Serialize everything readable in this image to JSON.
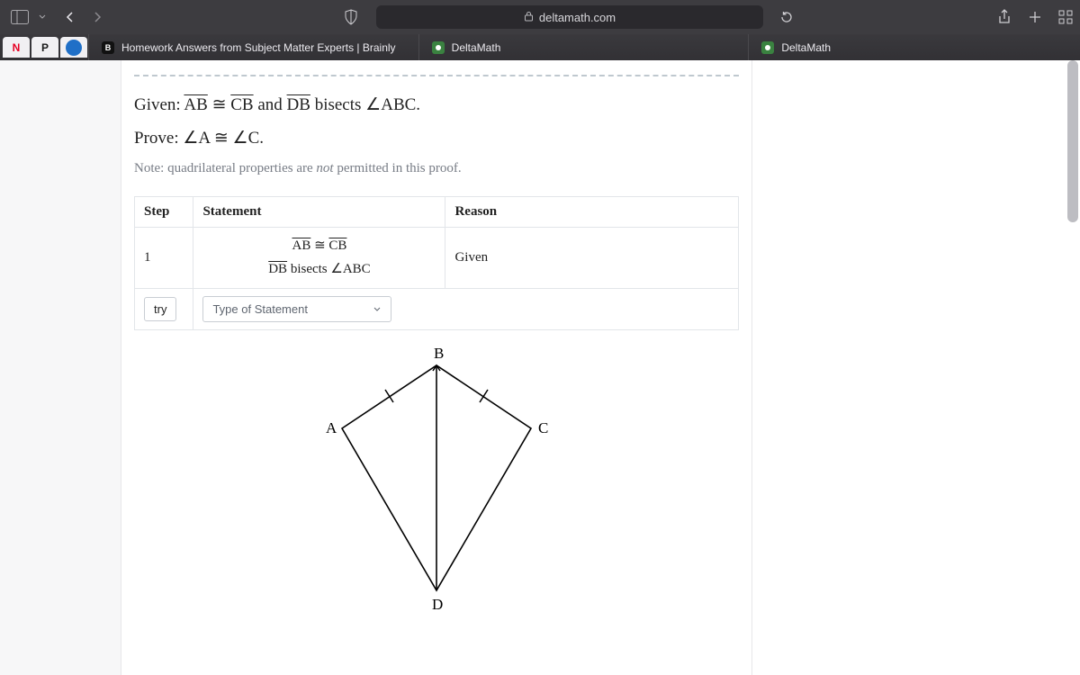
{
  "browser": {
    "url_domain": "deltamath.com",
    "tabs": [
      {
        "label": "Homework Answers from Subject Matter Experts | Brainly"
      },
      {
        "label": "DeltaMath"
      },
      {
        "label": "DeltaMath"
      }
    ],
    "favicons": {
      "n": "N",
      "p": "P",
      "brainly": "B"
    }
  },
  "problem": {
    "given_label": "Given:",
    "given_seg1": "AB",
    "given_cong": "≅",
    "given_seg2": "CB",
    "given_and": "and",
    "given_seg3": "DB",
    "given_bisects": "bisects",
    "given_angle": "ABC",
    "given_period": ".",
    "prove_label": "Prove:",
    "prove_a": "A",
    "prove_c": "C",
    "note_pre": "Note: quadrilateral properties are",
    "note_em": "not",
    "note_post": "permitted in this proof."
  },
  "proof_table": {
    "headers": {
      "step": "Step",
      "statement": "Statement",
      "reason": "Reason"
    },
    "row1": {
      "step": "1",
      "stmt_line1_a": "AB",
      "stmt_line1_b": "CB",
      "stmt_line2_seg": "DB",
      "stmt_line2_word": "bisects",
      "stmt_line2_ang": "ABC",
      "reason": "Given"
    },
    "row2": {
      "try": "try",
      "placeholder": "Type of Statement"
    }
  },
  "figure": {
    "labels": {
      "A": "A",
      "B": "B",
      "C": "C",
      "D": "D"
    }
  }
}
